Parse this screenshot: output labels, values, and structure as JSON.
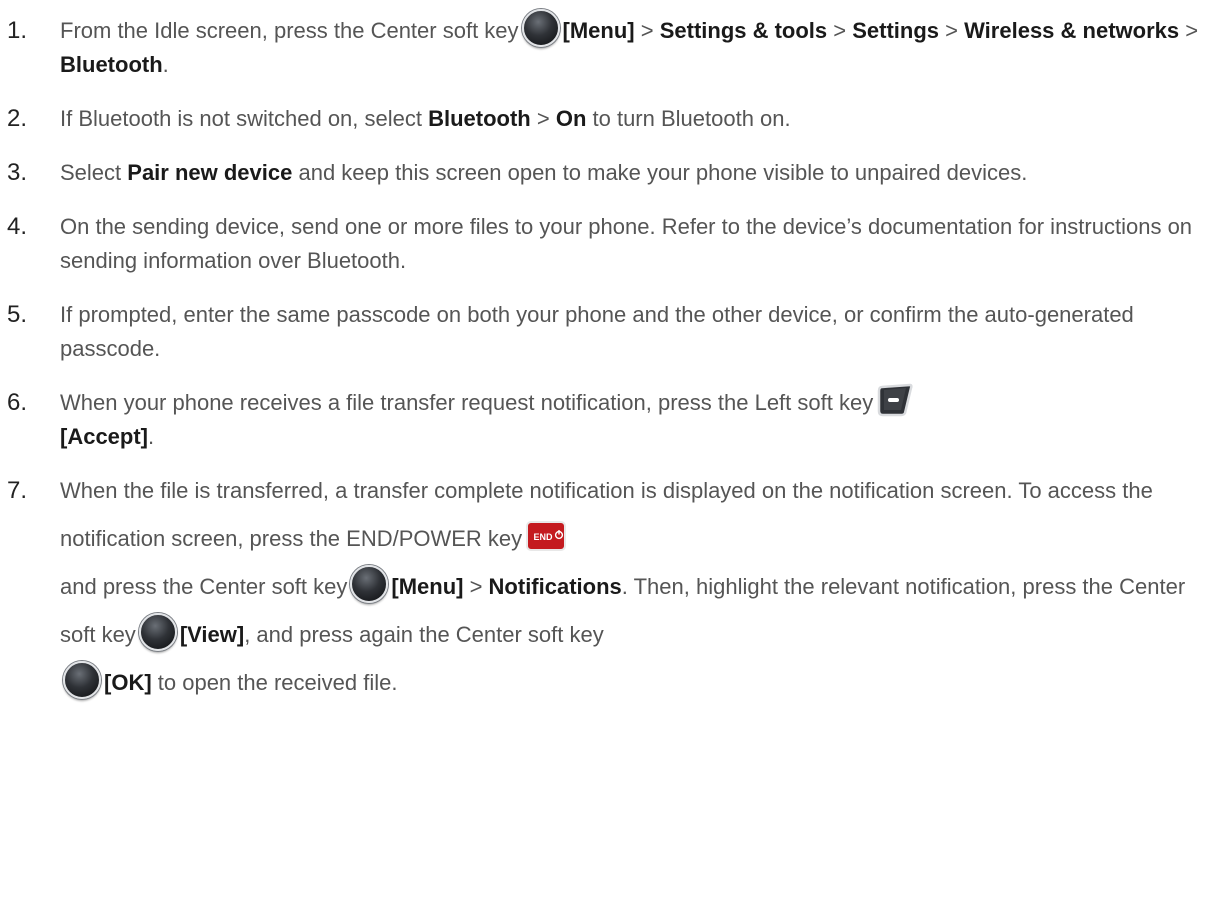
{
  "icons": {
    "center_soft_key": "center-soft-key-icon",
    "left_soft_key": "left-soft-key-icon",
    "end_power_key": "end-power-key-icon",
    "end_key_label": "END",
    "key_colors": {
      "soft_key_body": "#2f3237",
      "end_key_red": "#c41a1f"
    }
  },
  "steps": [
    {
      "num": "1.",
      "t1": "From the Idle screen, press the Center soft key",
      "b1": "[Menu]",
      "t2": " > ",
      "b2": "Settings & tools",
      "t3": " > ",
      "b3": "Settings",
      "t4": " > ",
      "b4": "Wireless & networks",
      "t5": " > ",
      "b5": "Bluetooth",
      "t6": "."
    },
    {
      "num": "2.",
      "t1": "If Bluetooth is not switched on, select ",
      "b1": "Bluetooth",
      "t2": " > ",
      "b2": "On",
      "t3": " to turn Bluetooth on."
    },
    {
      "num": "3.",
      "t1": "Select ",
      "b1": "Pair new device",
      "t2": " and keep this screen open to make your phone visible to unpaired devices."
    },
    {
      "num": "4.",
      "t1": "On the sending device, send one or more files to your phone. Refer to the device’s documentation for instructions on sending information over Bluetooth."
    },
    {
      "num": "5.",
      "t1": "If prompted, enter the same passcode on both your phone and the other device, or confirm the auto-generated passcode."
    },
    {
      "num": "6.",
      "t1": "When your phone receives a file transfer request notification, press the Left soft key",
      "b1": "[Accept]",
      "t2": "."
    },
    {
      "num": "7.",
      "t1": "When the file is transferred, a transfer complete notification is displayed on the notification screen. To access the notification screen, press the END/POWER key",
      "t2": "and press the Center soft key",
      "b1": "[Menu]",
      "t3": " > ",
      "b2": "Notifications",
      "t4": ". Then, highlight the relevant notification, press the Center soft key",
      "b3": "[View]",
      "t5": ", and press again the Center soft key",
      "b4": "[OK]",
      "t6": " to open the received file."
    }
  ]
}
